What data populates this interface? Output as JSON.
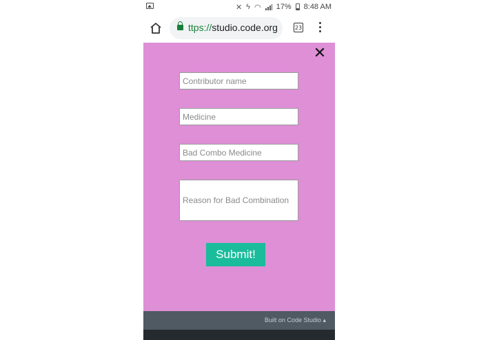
{
  "status_bar": {
    "battery_percent": "17%",
    "time": "8:48 AM",
    "icons": [
      "image-icon",
      "mute-icon",
      "data-saver-icon",
      "wifi-icon",
      "signal-icon",
      "battery-icon"
    ]
  },
  "browser": {
    "url_scheme": "ttps://",
    "url_host": "studio.code.org",
    "tab_count": "23",
    "icons": [
      "home-icon",
      "lock-icon",
      "tabs-icon",
      "more-vert-icon"
    ]
  },
  "app": {
    "background": "#de8fd6",
    "close_icon": "close-icon",
    "fields": {
      "contributor_placeholder": "Contributor name",
      "medicine_placeholder": "Medicine",
      "bad_combo_placeholder": "Bad Combo Medicine",
      "reason_placeholder": "Reason for Bad Combination"
    },
    "submit_label": "Submit!",
    "submit_color": "#1abc9c"
  },
  "footer": {
    "text": "Built on Code Studio ▴"
  }
}
